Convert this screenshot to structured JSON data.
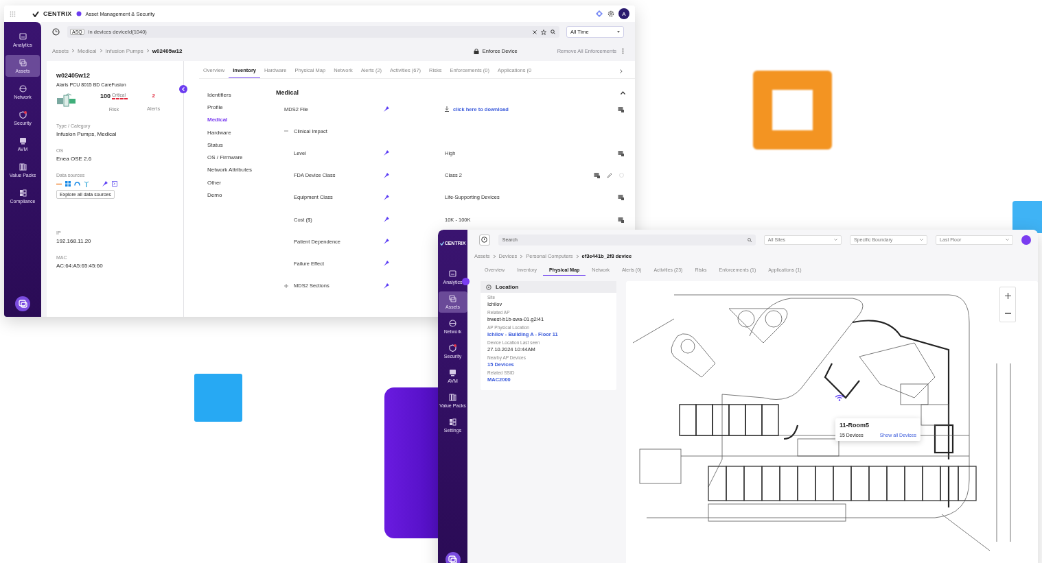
{
  "window_1": {
    "header": {
      "logo": "CENTRIX",
      "app_name": "Asset Management & Security",
      "avatar": "A"
    },
    "sidebar": [
      {
        "label": "Analytics",
        "selected": false
      },
      {
        "label": "Assets",
        "selected": true
      },
      {
        "label": "Network",
        "selected": false
      },
      {
        "label": "Security",
        "selected": false
      },
      {
        "label": "AVM",
        "selected": false
      },
      {
        "label": "Value Packs",
        "selected": false
      },
      {
        "label": "Compliance",
        "selected": false
      }
    ],
    "search": {
      "badge": "ASQ",
      "value": "in devices deviceId(1040)"
    },
    "time_filter": "All Time",
    "breadcrumb": [
      "Assets",
      "Medical",
      "Infusion Pumps",
      "w02405w12"
    ],
    "actions": {
      "enforce": "Enforce Device",
      "remove": {
        "label": "Remove All Enforcements",
        "disabled": true
      }
    },
    "device": {
      "name": "w02405w12",
      "model": "Alaris PCU 8015  BD CareFusion",
      "risk_score": "100",
      "risk_level": "Critical",
      "risk_label": "Risk",
      "alerts": "2",
      "alerts_label": "Alerts",
      "fields": [
        {
          "kind": "text",
          "label": "Type / Category",
          "value": "Infusion Pumps, Medical"
        },
        {
          "kind": "text",
          "label": "OS",
          "value": "Enea OSE 2.6"
        },
        {
          "kind": "sources",
          "label": "Data sources",
          "button": "Explore all data sources"
        },
        {
          "kind": "text",
          "label": "IP",
          "value": "192.168.11.20"
        },
        {
          "kind": "text",
          "label": "MAC",
          "value": "AC:64:A5:65:45:60"
        }
      ]
    },
    "tabs": [
      {
        "label": "Overview",
        "selected": false
      },
      {
        "label": "Inventory",
        "selected": true
      },
      {
        "label": "Hardware",
        "selected": false
      },
      {
        "label": "Physical Map",
        "selected": false
      },
      {
        "label": "Network",
        "selected": false
      },
      {
        "label": "Alerts (2)",
        "selected": false
      },
      {
        "label": "Activities (67)",
        "selected": false
      },
      {
        "label": "Risks",
        "selected": false
      },
      {
        "label": "Enforcements (0)",
        "selected": false
      },
      {
        "label": "Applications (0",
        "selected": false
      }
    ],
    "inventory_nav": [
      {
        "label": "Identifiers",
        "selected": false
      },
      {
        "label": "Profile",
        "selected": false
      },
      {
        "label": "Medical",
        "selected": true
      },
      {
        "label": "Hardware",
        "selected": false
      },
      {
        "label": "Status",
        "selected": false
      },
      {
        "label": "OS / Firmware",
        "selected": false
      },
      {
        "label": "Network Attributes",
        "selected": false
      },
      {
        "label": "Other",
        "selected": false
      },
      {
        "label": "Demo",
        "selected": false
      }
    ],
    "section": {
      "title": "Medical",
      "expanded": true,
      "rows": [
        {
          "kind": "file",
          "label": "MDS2 File",
          "value": "click here to download"
        },
        {
          "kind": "group",
          "label": "Clinical Impact",
          "expanded": true,
          "children": [
            {
              "label": "Level",
              "value": "High",
              "editable": false
            },
            {
              "label": "FDA Device Class",
              "value": "Class 2",
              "editable": true
            },
            {
              "label": "Equipment Class",
              "value": "Life-Supporting Devices",
              "editable": false
            },
            {
              "label": "Cost ($)",
              "value": "10K - 100K",
              "editable": false
            },
            {
              "label": "Patient Dependence"
            },
            {
              "label": "Failure Effect"
            }
          ]
        },
        {
          "kind": "group",
          "label": "MDS2 Sections",
          "expanded": false,
          "children": []
        }
      ]
    }
  },
  "window_2": {
    "header": {
      "logo": "CENTRIX"
    },
    "sidebar": [
      {
        "label": "Analytics",
        "selected": false
      },
      {
        "label": "Assets",
        "selected": true
      },
      {
        "label": "Network",
        "selected": false
      },
      {
        "label": "Security",
        "selected": false
      },
      {
        "label": "AVM",
        "selected": false
      },
      {
        "label": "Value Packs",
        "selected": false
      },
      {
        "label": "Settings",
        "selected": false
      }
    ],
    "search": {
      "placeholder": "Search"
    },
    "filters": [
      "All Sites",
      "Specific Boundary",
      "Last Floor"
    ],
    "breadcrumb": [
      "Assets",
      "Devices",
      "Personal Computers",
      "ef3e441b_2f8 device"
    ],
    "tabs": [
      {
        "label": "Overview",
        "selected": false
      },
      {
        "label": "Inventory",
        "selected": false
      },
      {
        "label": "Physical Map",
        "selected": true
      },
      {
        "label": "Network",
        "selected": false
      },
      {
        "label": "Alerts (0)",
        "selected": false
      },
      {
        "label": "Activities (23)",
        "selected": false
      },
      {
        "label": "Risks",
        "selected": false
      },
      {
        "label": "Enforcements (1)",
        "selected": false
      },
      {
        "label": "Applications (1)",
        "selected": false
      }
    ],
    "location": {
      "title": "Location",
      "fields": [
        {
          "kind": "text",
          "label": "Site",
          "value": "Ichilov"
        },
        {
          "kind": "text",
          "label": "Related AP",
          "value": "bwest-b1b-swa-01.g2/41"
        },
        {
          "kind": "link",
          "label": "AP Physical Location",
          "value": "Ichilov - Building A - Floor 11"
        },
        {
          "kind": "text",
          "label": "Device Location Last seen",
          "value": "27.10.2024 10:44AM"
        },
        {
          "kind": "link",
          "label": "Nearby AP Devices",
          "value": "15 Devices"
        },
        {
          "kind": "link",
          "label": "Related SSID",
          "value": "MAC2000"
        }
      ]
    },
    "map": {
      "popup": {
        "title": "11-Room5",
        "count": "15 Devices",
        "link": "Show all Devices"
      }
    }
  }
}
